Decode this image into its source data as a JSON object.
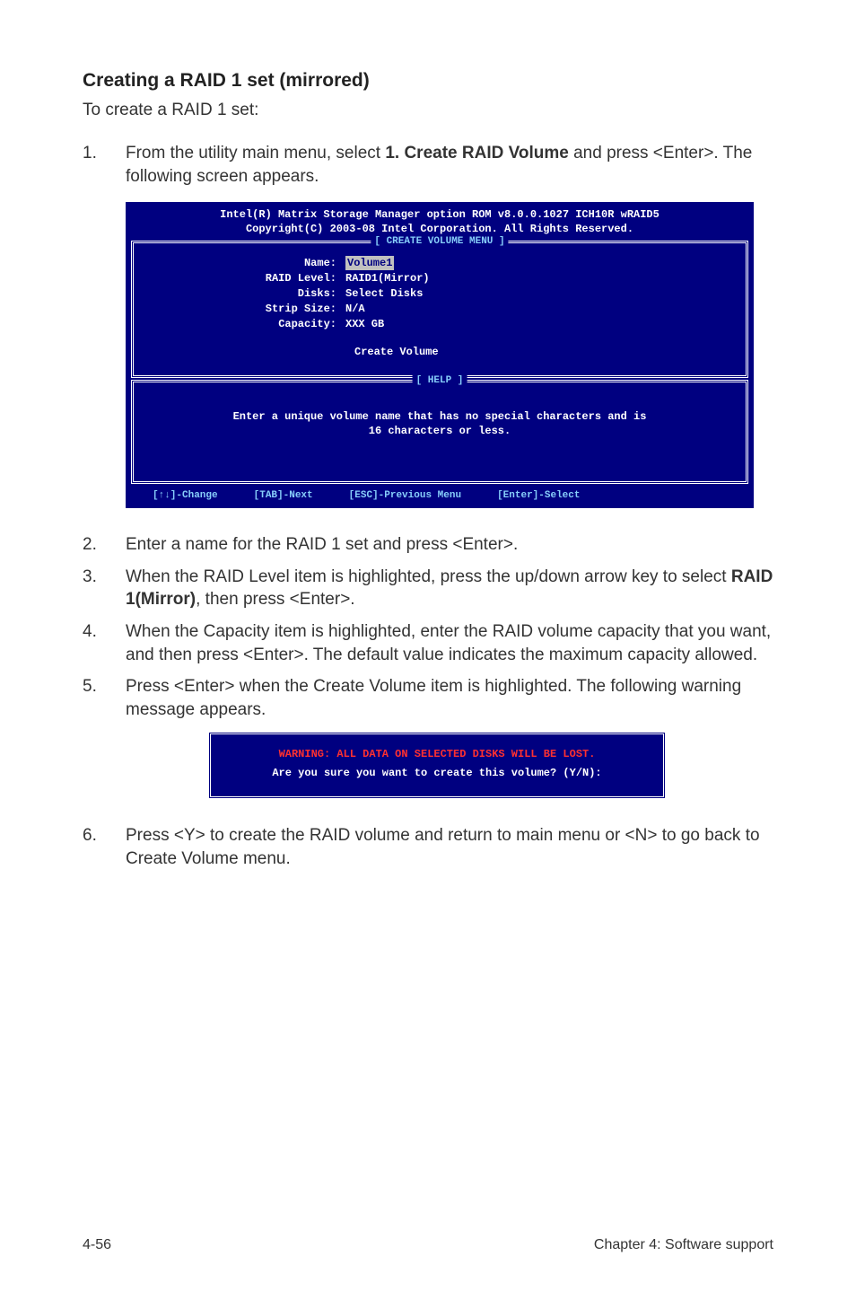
{
  "heading": "Creating a RAID 1 set (mirrored)",
  "intro": "To create a RAID 1 set:",
  "steps": {
    "s1_a": "From the utility main menu, select ",
    "s1_bold": "1. Create RAID Volume",
    "s1_b": " and press <Enter>. The following screen appears.",
    "s2": "Enter a name for the RAID 1 set and press <Enter>.",
    "s3_a": "When the RAID Level item is highlighted, press the up/down arrow key to select ",
    "s3_bold": "RAID 1(Mirror)",
    "s3_b": ", then press <Enter>.",
    "s4": "When the Capacity item is highlighted, enter the RAID volume capacity that you want, and then press <Enter>. The default value indicates the maximum capacity allowed.",
    "s5": "Press <Enter> when the Create Volume item is highlighted. The following warning message appears.",
    "s6": "Press <Y> to create the RAID volume and return to main menu or <N> to go back to Create Volume menu."
  },
  "bios": {
    "title1": "Intel(R) Matrix Storage Manager option ROM v8.0.0.1027 ICH10R wRAID5",
    "title2": "Copyright(C) 2003-08 Intel Corporation. All Rights Reserved.",
    "box1label": "[ CREATE VOLUME MENU ]",
    "labels": {
      "name": "Name:",
      "raid": "RAID Level:",
      "disks": "Disks:",
      "strip": "Strip Size:",
      "cap": "Capacity:"
    },
    "values": {
      "name": "Volume1",
      "raid": "RAID1(Mirror)",
      "disks": "Select Disks",
      "strip": "N/A",
      "cap": "XXX   GB"
    },
    "create": "Create Volume",
    "box2label": "[ HELP ]",
    "help1": "Enter a unique volume name that has no special characters and is",
    "help2": "16 characters or less.",
    "footer": {
      "change": "[↑↓]-Change",
      "next": "[TAB]-Next",
      "prev": "[ESC]-Previous Menu",
      "select": "[Enter]-Select"
    }
  },
  "warn": {
    "line1": "WARNING: ALL DATA ON SELECTED DISKS WILL BE LOST.",
    "line2": "Are you sure you want to create this volume? (Y/N):"
  },
  "footer": {
    "left": "4-56",
    "right": "Chapter 4: Software support"
  }
}
